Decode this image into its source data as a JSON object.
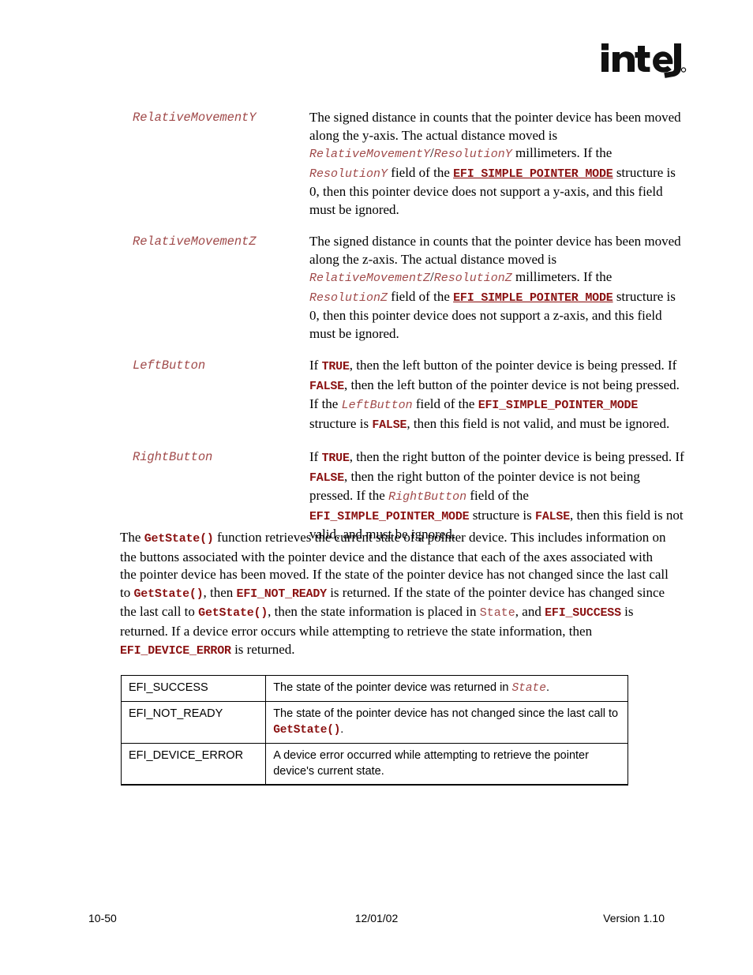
{
  "logo": {
    "name": "intel-logo",
    "wordmark": "intel",
    "registered_mark": "®"
  },
  "definitions": [
    {
      "term": "RelativeMovementY",
      "segments": [
        {
          "t": "The signed distance in counts that the pointer device has been moved along the y-axis.  The actual distance moved is ",
          "s": "plain"
        },
        {
          "t": "RelativeMovementY",
          "s": "code-it"
        },
        {
          "t": "/",
          "s": "plain"
        },
        {
          "t": "ResolutionY",
          "s": "code-it"
        },
        {
          "t": " millimeters.  If the ",
          "s": "plain"
        },
        {
          "t": "ResolutionY",
          "s": "code-it"
        },
        {
          "t": " field of the ",
          "s": "plain"
        },
        {
          "t": "EFI_SIMPLE_POINTER_MODE",
          "s": "code-link"
        },
        {
          "t": " structure is 0, then this pointer device does not support a y-axis, and this field must be ignored.",
          "s": "plain"
        }
      ]
    },
    {
      "term": "RelativeMovementZ",
      "segments": [
        {
          "t": "The signed distance in counts that the pointer device has been moved along the z-axis.  The actual distance moved is ",
          "s": "plain"
        },
        {
          "t": "RelativeMovementZ",
          "s": "code-it"
        },
        {
          "t": "/",
          "s": "plain"
        },
        {
          "t": "ResolutionZ",
          "s": "code-it"
        },
        {
          "t": " millimeters.  If the ",
          "s": "plain"
        },
        {
          "t": "ResolutionZ",
          "s": "code-it"
        },
        {
          "t": " field of the ",
          "s": "plain"
        },
        {
          "t": "EFI_SIMPLE_POINTER_MODE",
          "s": "code-link"
        },
        {
          "t": " structure is 0, then this pointer device does not support a z-axis, and this field must be ignored.",
          "s": "plain"
        }
      ]
    },
    {
      "term": "LeftButton",
      "segments": [
        {
          "t": "If ",
          "s": "plain"
        },
        {
          "t": "TRUE",
          "s": "code-bd"
        },
        {
          "t": ", then the left button of the pointer device is being pressed.  If ",
          "s": "plain"
        },
        {
          "t": "FALSE",
          "s": "code-bd"
        },
        {
          "t": ", then the left button of the pointer device is not being pressed.  If the ",
          "s": "plain"
        },
        {
          "t": "LeftButton",
          "s": "code-it"
        },
        {
          "t": " field of the ",
          "s": "plain"
        },
        {
          "t": "EFI_SIMPLE_POINTER_MODE",
          "s": "code-bd"
        },
        {
          "t": " structure is ",
          "s": "plain"
        },
        {
          "t": "FALSE",
          "s": "code-bd"
        },
        {
          "t": ", then this field is not valid, and must be ignored.",
          "s": "plain"
        }
      ]
    },
    {
      "term": "RightButton",
      "segments": [
        {
          "t": "If ",
          "s": "plain"
        },
        {
          "t": "TRUE",
          "s": "code-bd"
        },
        {
          "t": ", then the right button of the pointer device is being pressed.  If ",
          "s": "plain"
        },
        {
          "t": "FALSE",
          "s": "code-bd"
        },
        {
          "t": ", then the right button of the pointer device is not being pressed.  If the ",
          "s": "plain"
        },
        {
          "t": "RightButton",
          "s": "code-it"
        },
        {
          "t": " field of the ",
          "s": "plain"
        },
        {
          "t": "EFI_SIMPLE_POINTER_MODE",
          "s": "code-bd"
        },
        {
          "t": " structure is ",
          "s": "plain"
        },
        {
          "t": "FALSE",
          "s": "code-bd"
        },
        {
          "t": ", then this field is not valid, and must be ignored.",
          "s": "plain"
        }
      ]
    }
  ],
  "description": {
    "segments": [
      {
        "t": "The ",
        "s": "plain"
      },
      {
        "t": "GetState()",
        "s": "code-bd"
      },
      {
        "t": " function retrieves the current state of a pointer device.  This includes information on the buttons associated with the pointer device and the distance that each of the axes associated with the pointer device has been moved.  If the state of the pointer device has not changed since the last call to ",
        "s": "plain"
      },
      {
        "t": "GetState()",
        "s": "code-bd"
      },
      {
        "t": ", then ",
        "s": "plain"
      },
      {
        "t": "EFI_NOT_READY",
        "s": "code-bd"
      },
      {
        "t": " is returned.  If the state of the pointer device has changed since the last call to ",
        "s": "plain"
      },
      {
        "t": "GetState()",
        "s": "code-bd"
      },
      {
        "t": ", then the state information is placed in ",
        "s": "plain"
      },
      {
        "t": "State",
        "s": "code-pl"
      },
      {
        "t": ", and ",
        "s": "plain"
      },
      {
        "t": "EFI_SUCCESS",
        "s": "code-bd"
      },
      {
        "t": " is returned.  If a device error occurs while attempting to retrieve the state information, then ",
        "s": "plain"
      },
      {
        "t": "EFI_DEVICE_ERROR",
        "s": "code-bd"
      },
      {
        "t": " is returned.",
        "s": "plain"
      }
    ]
  },
  "status_table": {
    "rows": [
      {
        "code": "EFI_SUCCESS",
        "segments": [
          {
            "t": "The state of the pointer device was returned in ",
            "s": "plain"
          },
          {
            "t": "State",
            "s": "code-it"
          },
          {
            "t": ".",
            "s": "plain"
          }
        ]
      },
      {
        "code": "EFI_NOT_READY",
        "segments": [
          {
            "t": "The state of the pointer device has not changed since the last call to ",
            "s": "plain"
          },
          {
            "t": "GetState()",
            "s": "code-bd"
          },
          {
            "t": ".",
            "s": "plain"
          }
        ]
      },
      {
        "code": "EFI_DEVICE_ERROR",
        "segments": [
          {
            "t": "A device error occurred while attempting to retrieve the pointer device's current state.",
            "s": "plain"
          }
        ]
      }
    ]
  },
  "footer": {
    "page_number": "10-50",
    "date": "12/01/02",
    "version": "Version 1.10"
  },
  "colors": {
    "code_light_red": "#a04a4a",
    "code_dark_maroon": "#8a1010",
    "text_black": "#000000",
    "page_background": "#ffffff"
  }
}
